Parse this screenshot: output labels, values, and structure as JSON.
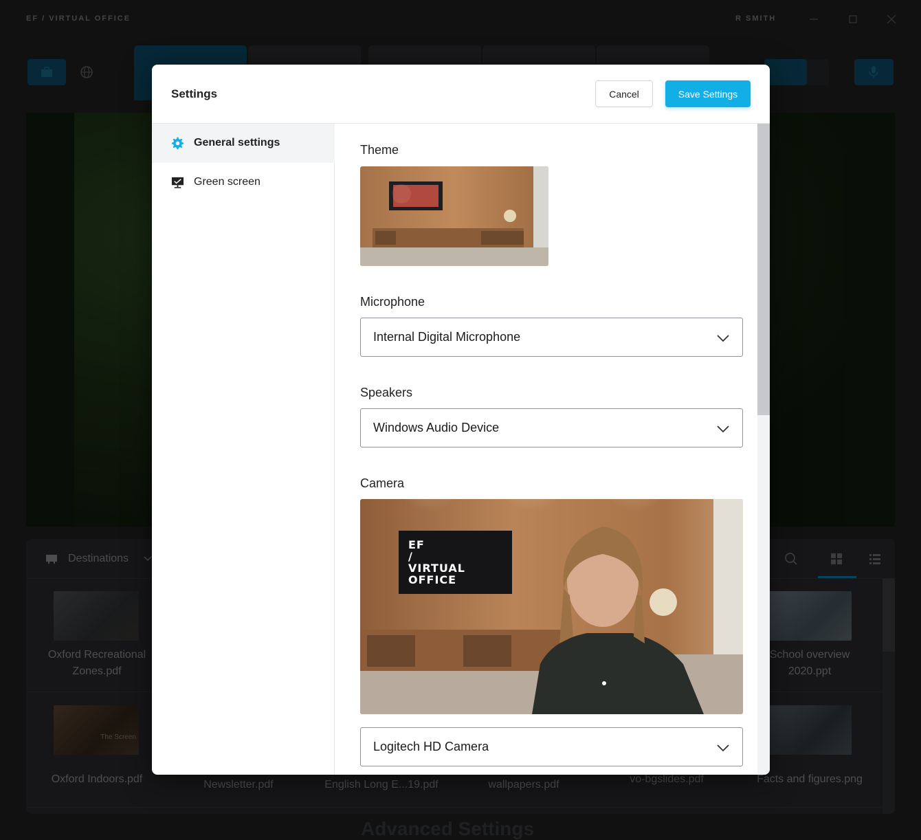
{
  "app": {
    "title": "EF / VIRTUAL OFFICE",
    "user": "R SMITH"
  },
  "window_controls": [
    "minimize-icon",
    "maximize-icon",
    "close-icon"
  ],
  "files_panel": {
    "folder_label": "Destinations",
    "files": [
      {
        "name_line1": "Oxford Recreational",
        "name_line2": "Zones.pdf"
      },
      {
        "name_line1": "School overview",
        "name_line2": "2020.ppt"
      },
      {
        "name_line1": "Oxford Indoors.pdf",
        "name_line2": ""
      },
      {
        "name_line1": "Newsletter.pdf",
        "name_line2": ""
      },
      {
        "name_line1": "English Long E...19.pdf",
        "name_line2": ""
      },
      {
        "name_line1": "wallpapers.pdf",
        "name_line2": ""
      },
      {
        "name_line1": "vo-bgslides.pdf",
        "name_line2": ""
      },
      {
        "name_line1": "Facts and figures.png",
        "name_line2": ""
      }
    ],
    "thumb_caption": "The Screen",
    "background_heading": "Advanced Settings"
  },
  "settings": {
    "title": "Settings",
    "cancel_label": "Cancel",
    "save_label": "Save Settings",
    "nav": [
      {
        "label": "General settings",
        "icon": "gear-icon",
        "active": true
      },
      {
        "label": "Green screen",
        "icon": "green-screen-icon",
        "active": false
      }
    ],
    "theme_label": "Theme",
    "microphone_label": "Microphone",
    "microphone_value": "Internal Digital Microphone",
    "speakers_label": "Speakers",
    "speakers_value": "Windows Audio Device",
    "camera_label": "Camera",
    "camera_value": "Logitech HD Camera",
    "camera_screen_text": {
      "line1": "EF",
      "line2": "/",
      "line3": "VIRTUAL",
      "line4": "OFFICE"
    }
  },
  "colors": {
    "accent": "#12aee6",
    "app_bg": "#1f2022",
    "toolbar_blue": "#0b4a66"
  }
}
